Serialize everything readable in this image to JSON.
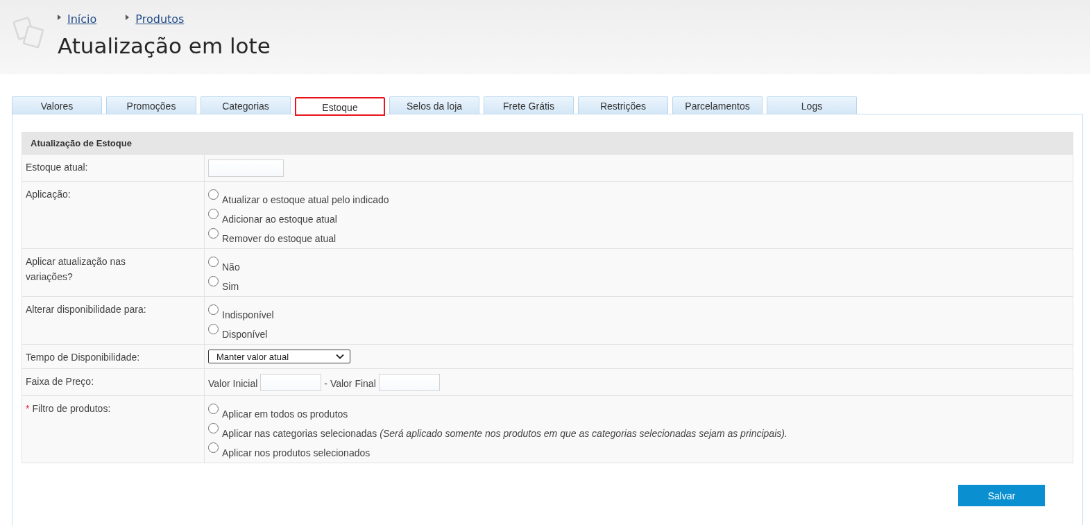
{
  "header": {
    "breadcrumbs": [
      {
        "label": "Início"
      },
      {
        "label": "Produtos"
      }
    ],
    "title": "Atualização em lote"
  },
  "tabs": [
    {
      "label": "Valores",
      "selected": false
    },
    {
      "label": "Promoções",
      "selected": false
    },
    {
      "label": "Categorias",
      "selected": false
    },
    {
      "label": "Estoque",
      "selected": true
    },
    {
      "label": "Selos da loja",
      "selected": false
    },
    {
      "label": "Frete Grátis",
      "selected": false
    },
    {
      "label": "Restrições",
      "selected": false
    },
    {
      "label": "Parcelamentos",
      "selected": false
    },
    {
      "label": "Logs",
      "selected": false
    }
  ],
  "form": {
    "title": "Atualização de Estoque",
    "rows": [
      {
        "kind": "input",
        "label": "Estoque atual:"
      },
      {
        "kind": "radios",
        "label": "Aplicação:",
        "options": [
          {
            "label": "Atualizar o estoque atual pelo indicado",
            "selected": false
          },
          {
            "label": "Adicionar ao estoque atual",
            "selected": false
          },
          {
            "label": "Remover do estoque atual",
            "selected": false
          }
        ]
      },
      {
        "kind": "radios",
        "label": "Aplicar atualização nas variações?",
        "options": [
          {
            "label": "Não",
            "selected": false
          },
          {
            "label": "Sim",
            "selected": false
          }
        ]
      },
      {
        "kind": "radios",
        "label": "Alterar disponibilidade para:",
        "options": [
          {
            "label": "Indisponível",
            "selected": false
          },
          {
            "label": "Disponível",
            "selected": false
          }
        ]
      },
      {
        "kind": "select",
        "label": "Tempo de Disponibilidade:",
        "value": "Manter valor atual"
      },
      {
        "kind": "range",
        "label": "Faixa de Preço:",
        "parts": [
          {
            "kind": "text",
            "text": "Valor Inicial"
          },
          {
            "kind": "input"
          },
          {
            "kind": "text",
            "text": "- Valor Final"
          },
          {
            "kind": "input"
          }
        ]
      },
      {
        "kind": "radios",
        "label": "Filtro de produtos:",
        "required_mark": "*",
        "options": [
          {
            "label": "Aplicar em todos os produtos",
            "selected": false
          },
          {
            "label": "Aplicar nas categorias selecionadas *(Será aplicado somente nos produtos em que as categorias selecionadas sejam as principais).*",
            "selected": false
          },
          {
            "label": "Aplicar nos produtos selecionados",
            "selected": false
          }
        ]
      }
    ]
  },
  "save_button": "Salvar"
}
